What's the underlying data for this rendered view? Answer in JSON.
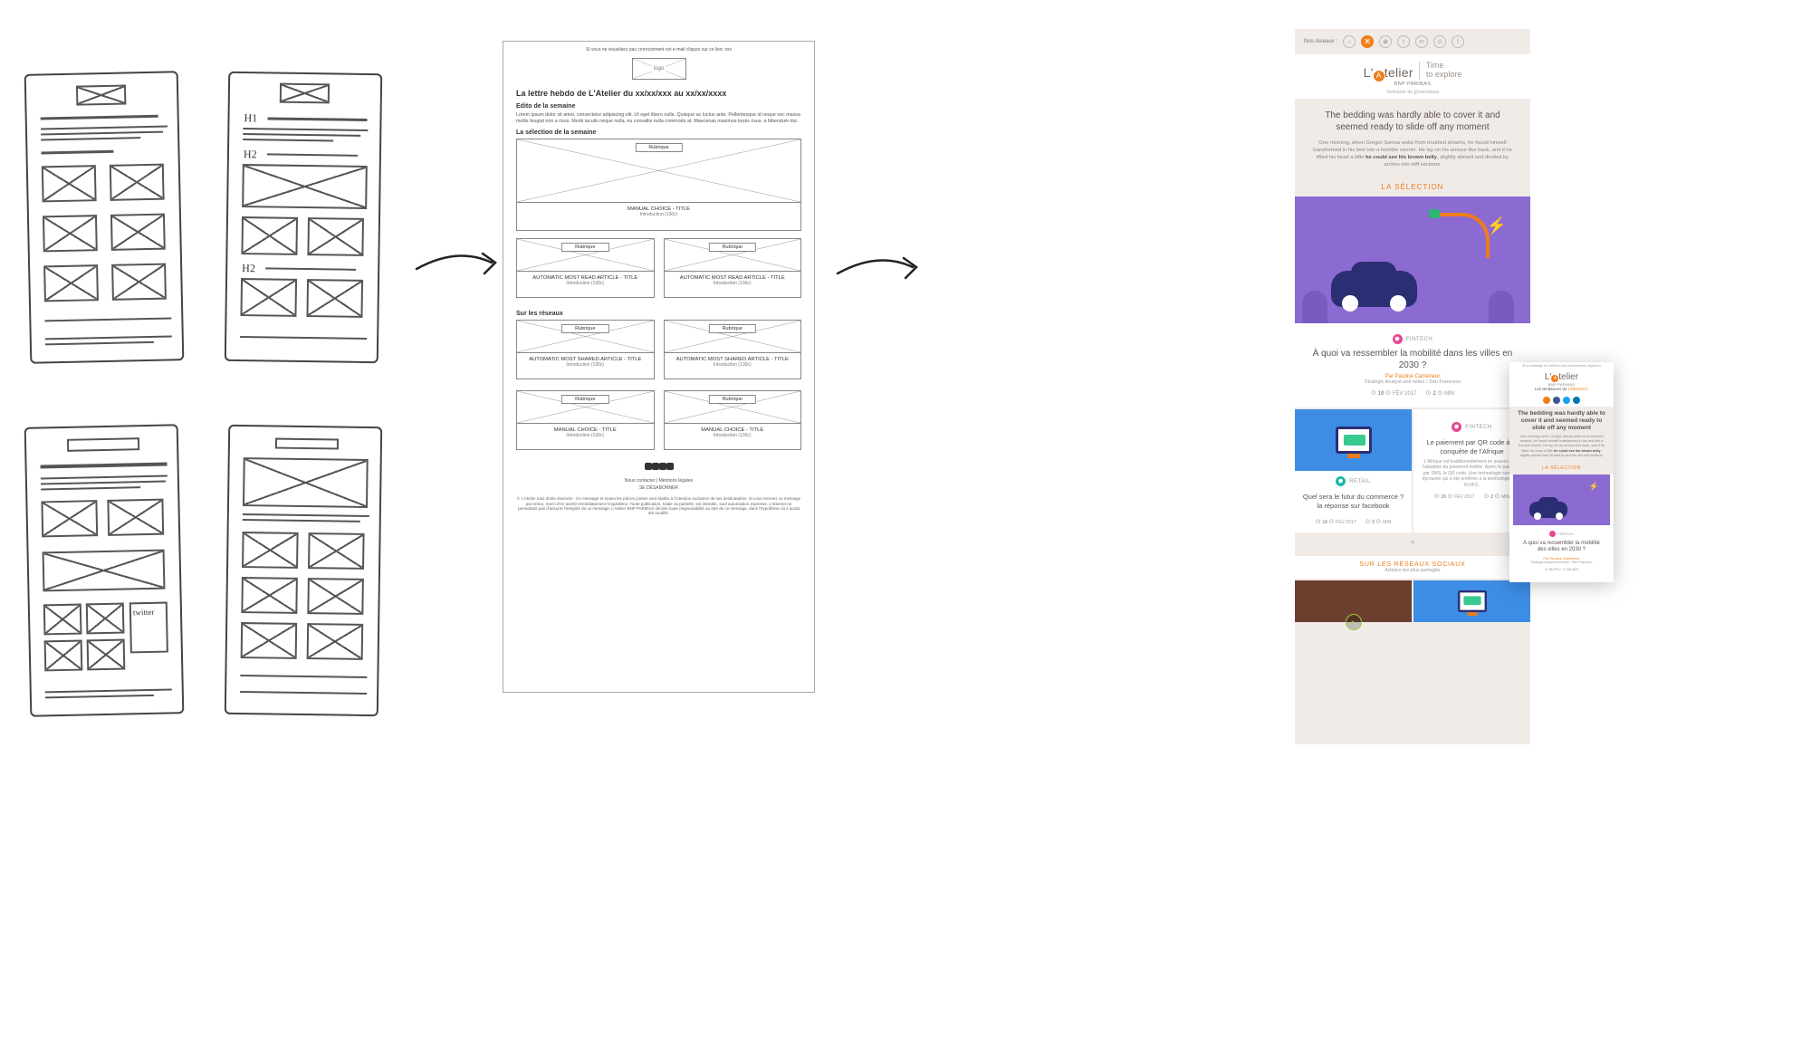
{
  "sketches": {
    "labels": {
      "h1": "H1",
      "h2a": "H2",
      "h2b": "H2",
      "twitter": "twitter"
    }
  },
  "wireframe": {
    "view_hint": "Si vous ne visualisez pas correctement cet e-mail cliquez sur ce lien: xxx",
    "logo_text": "logo",
    "title": "La lettre hebdo de L'Atelier du xx/xx/xxx au xx/xx/xxxx",
    "edito_h": "Edito de la semaine",
    "edito_body": "Lorem ipsum dolor sit amet, consectetur adipiscing elit. Ut eget libero nulla. Quisque ac luctus ante. Pellentesque id neque nec massa mollis feugiat non a risus. Morbi iaculis neque nulla, eu convallis nulla commodo at. Maecenas maximus turpis risus, a bibendum dui.",
    "selection_h": "La sélection de la semaine",
    "reseaux_h": "Sur les réseaux",
    "rubrique": "Rubrique",
    "manual_title": "MANUAL CHOICE - TITLE",
    "read_title": "AUTOMATIC MOST READ ARTICLE - TITLE",
    "shared_title": "AUTOMATIC MOST SHARED ARTICLE - TITLE",
    "intro": "Introduction (130c)",
    "contact": "Nous contacter | Mentions légales",
    "unsub": "SE DÉSABONNER",
    "legal": "© L'Atelier tous droits réservés - Ce message et toutes les pièces jointes sont établis à l'intention exclusive de ses destinataires. Si vous recevez ce message par erreur, merci d'en avertir immédiatement l'expéditeur. Toute publication, totale ou partielle, est interdite, sauf autorisation expresse. L'Internet ne permettant pas d'assurer l'intégrité de ce message, L'Atelier BNP PARIBAS décline toute responsabilité au titre de ce message, dans l'hypothèse où il aurait été modifié."
  },
  "final": {
    "networks_label": "Nos réseaux :",
    "brand": "L'Atelier",
    "brand_sub": "BNP PARIBAS",
    "brand_a": "A",
    "tagline1": "Time",
    "tagline2": "to explore",
    "week": "Semaine du jj/mm/aaaa",
    "hero_title": "The bedding was hardly able to cover it and seemed ready to slide off any moment",
    "hero_body_1": "One morning, when Gregor Samsa woke from troubled dreams, he found himself transformed in his bed into a horrible vermin. He lay on his armour-like back, and if he lifted his head a little ",
    "hero_bold": "he could see his brown belly",
    "hero_body_2": ", slightly domed and divided by arches into stiff sections.",
    "selection_h": "LA SÉLECTION",
    "article": {
      "cat": "FINTECH",
      "title": "À quoi va ressembler la mobilité dans les villes en 2030 ?",
      "author": "Par Pauline Canteneur",
      "author_sub": "Strategic Analyst and writer / San Francisco",
      "date": "19",
      "date_sub": "FÉV 2017",
      "time": "2",
      "time_sub": "MIN"
    },
    "card_left": {
      "cat": "RETAIL",
      "title": "Quel sera le futur du commerce ? la réponse sur facebook",
      "date": "19",
      "date_sub": "FÉV 2017",
      "time": "5",
      "time_sub": "MIN"
    },
    "card_right": {
      "cat": "FINTECH",
      "title": "Le paiement par QR code à la conquête de l'Afrique",
      "body": "L'Afrique est traditionnellement en avance dans l'adoption du paiement mobile. Après le paiement par SMS, le QR code. Une technologie simple et éprouvée qui a été préférée à la technologie sans fil NFC.",
      "date": "19",
      "date_sub": "FÉV 2017",
      "time": "2",
      "time_sub": "MIN"
    },
    "plus": "+",
    "social_h1": "SUR LES RÉSEAUX SOCIAUX",
    "social_h2": "Articles les plus partagés"
  },
  "mobile": {
    "hint": "Si ce message ne s'affiche pas correctement, cliquez ici",
    "brand": "L'Atelier",
    "brand_a": "A",
    "brand_sub": "BNP PARIBAS",
    "date_prefix": "Les tendances du ",
    "date": "23/02/2017",
    "hero_title": "The bedding was hardly able to cover it and seemed ready to slide off any moment",
    "hero_body_1": "One morning, when Gregor Samsa woke from troubled dreams, he found himself transformed in his bed into a horrible vermin. He lay on his armour-like back, and if he lifted his head a little ",
    "hero_bold": "he could see his brown belly",
    "hero_body_2": ", slightly domed and divided by arches into stiff sections.",
    "selection_h": "LA SÉLECTION",
    "article": {
      "cat": "FINTECH",
      "title": "A quoi va ressembler la mobilité des villes en 2030 ?",
      "author": "Par Pauline Canteneur",
      "author_sub": "Strategic Analyst and writer / San Francisco",
      "date": "13",
      "date_sub": "FÉV",
      "time": "10",
      "time_sub": "MIN"
    }
  }
}
